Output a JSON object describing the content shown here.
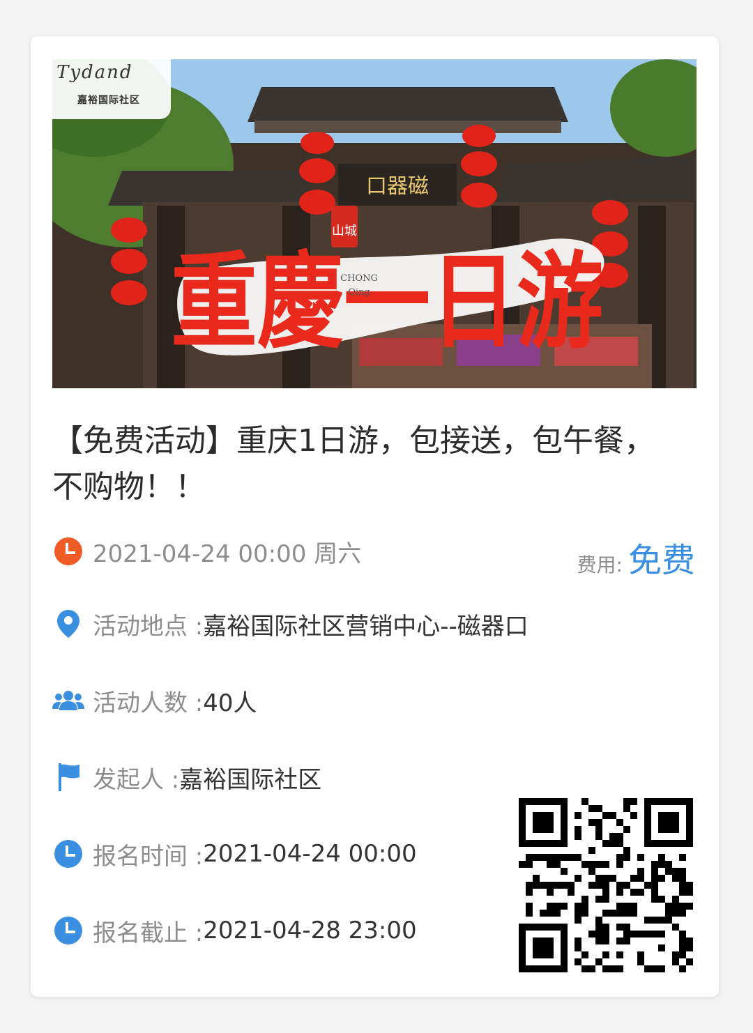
{
  "banner": {
    "logo_script": "Tydand",
    "logo_cn": "嘉裕国际社区",
    "headline": "重慶一日游",
    "headline_small": "山城",
    "pinyin_top": "CHONG",
    "pinyin_bottom": "Qing",
    "gate_sign": "口器磁"
  },
  "event": {
    "title": "【免费活动】重庆1日游，包接送，包午餐，不购物！！",
    "datetime": "2021-04-24 00:00  周六",
    "fee_label": "费用:",
    "fee_value": "免费",
    "location_label": "活动地点 : ",
    "location_value": "嘉裕国际社区营销中心--磁器口",
    "people_label": "活动人数 : ",
    "people_value": "40人",
    "organizer_label": "发起人 : ",
    "organizer_value": "嘉裕国际社区",
    "signup_time_label": "报名时间 : ",
    "signup_time_value": "2021-04-24 00:00",
    "signup_deadline_label": "报名截止 : ",
    "signup_deadline_value": "2021-04-28 23:00"
  },
  "icons": {
    "clock_orange": "clock-icon",
    "location": "map-pin-icon",
    "people": "users-icon",
    "flag": "flag-icon",
    "clock_blue": "clock-icon"
  },
  "colors": {
    "accent_blue": "#3b8fe0",
    "clock_orange": "#f05a24",
    "headline_red": "#e8291c"
  }
}
